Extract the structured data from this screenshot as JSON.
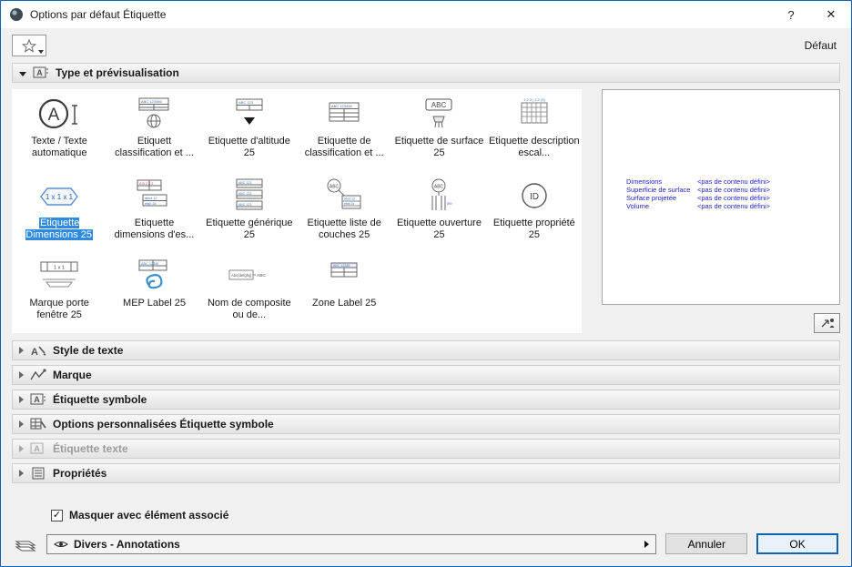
{
  "window": {
    "title": "Options par défaut Étiquette",
    "help_label": "?",
    "close_label": "✕"
  },
  "toolbar": {
    "default_label": "Défaut"
  },
  "sections": {
    "type_preview": {
      "label": "Type et prévisualisation"
    },
    "text_style": {
      "label": "Style de texte"
    },
    "marque": {
      "label": "Marque"
    },
    "etiquette_symbole": {
      "label": "Étiquette symbole"
    },
    "options_perso": {
      "label": "Options personnalisées Étiquette symbole"
    },
    "etiquette_texte": {
      "label": "Étiquette texte"
    },
    "proprietes": {
      "label": "Propriétés"
    }
  },
  "grid": {
    "items": [
      {
        "label": "Texte / Texte automatique"
      },
      {
        "label": "Etiquett classification et ..."
      },
      {
        "label": "Etiquette d'altitude 25"
      },
      {
        "label": "Etiquette de classification et ..."
      },
      {
        "label": "Etiquette de surface 25"
      },
      {
        "label": "Etiquette description escal..."
      },
      {
        "label": "Etiquette Dimensions 25",
        "selected": true
      },
      {
        "label": "Etiquette dimensions d'es..."
      },
      {
        "label": "Etiquette générique 25"
      },
      {
        "label": "Etiquette liste de couches 25"
      },
      {
        "label": "Etiquette ouverture 25"
      },
      {
        "label": "Etiquette propriété 25"
      },
      {
        "label": "Marque porte fenêtre 25"
      },
      {
        "label": "MEP Label 25"
      },
      {
        "label": "Nom de composite ou de..."
      },
      {
        "label": "Zone Label 25"
      }
    ]
  },
  "preview": {
    "rows": [
      {
        "name": "Dimensions",
        "value": "<pas de contenu défini>"
      },
      {
        "name": "Superficie de surface",
        "value": "<pas de contenu défini>"
      },
      {
        "name": "Surface projetée",
        "value": "<pas de contenu défini>"
      },
      {
        "name": "Volume",
        "value": "<pas de contenu défini>"
      }
    ]
  },
  "footer": {
    "checkbox_label": "Masquer avec élément associé",
    "checkbox_checked": "✓",
    "layer_value": "Divers - Annotations",
    "cancel_label": "Annuler",
    "ok_label": "OK"
  },
  "colors": {
    "accent": "#0f64b4",
    "selection": "#2f8ae0",
    "preview_text": "#2222cc"
  }
}
